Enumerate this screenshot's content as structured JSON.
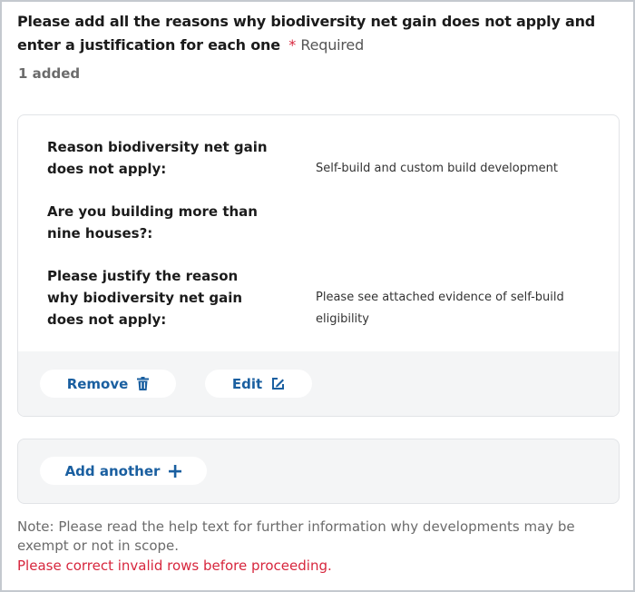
{
  "question": {
    "text": "Please add all the reasons why biodiversity net gain does not apply and enter a justification for each one",
    "required_star": "*",
    "required_text": "Required"
  },
  "count_text": "1 added",
  "entry": {
    "rows": [
      {
        "label": "Reason biodiversity net gain does not apply:",
        "value": "Self-build and custom build development"
      },
      {
        "label": "Are you building more than nine houses?:",
        "value": ""
      },
      {
        "label": "Please justify the reason why biodiversity net gain does not apply:",
        "value": "Please see attached evidence of self-build eligibility"
      }
    ],
    "remove_label": "Remove",
    "edit_label": "Edit"
  },
  "add_another_label": "Add another",
  "note": "Note: Please read the help text for further information why developments may be exempt or not in scope.",
  "error": "Please correct invalid rows before proceeding.",
  "colors": {
    "accent": "#1a5fa0",
    "error": "#d7263d",
    "muted_text": "#6b6b6b",
    "panel_bg": "#f4f5f6"
  },
  "icons": [
    "trash-icon",
    "edit-icon",
    "plus-icon"
  ]
}
